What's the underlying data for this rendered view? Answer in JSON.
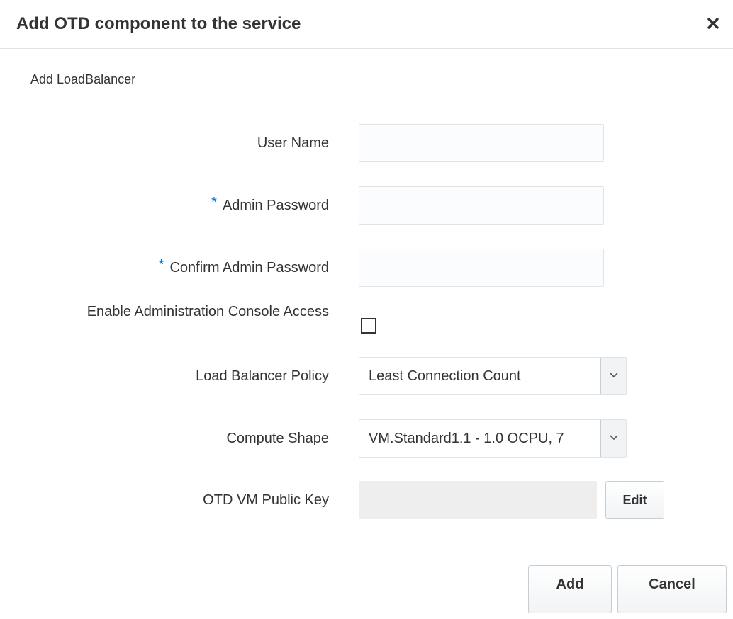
{
  "dialog": {
    "title": "Add OTD component to the service",
    "close_icon": "close-icon",
    "section_title": "Add LoadBalancer"
  },
  "form": {
    "user_name": {
      "label": "User Name",
      "value": "",
      "required": false
    },
    "admin_password": {
      "label": "Admin Password",
      "value": "",
      "required": true,
      "required_marker": "*"
    },
    "confirm_admin_password": {
      "label": "Confirm Admin Password",
      "value": "",
      "required": true,
      "required_marker": "*"
    },
    "enable_console": {
      "label": "Enable Administration Console Access",
      "checked": false
    },
    "load_balancer_policy": {
      "label": "Load Balancer Policy",
      "selected": "Least Connection Count"
    },
    "compute_shape": {
      "label": "Compute Shape",
      "selected": "VM.Standard1.1 - 1.0 OCPU, 7"
    },
    "public_key": {
      "label": "OTD VM Public Key",
      "value": "",
      "edit_label": "Edit"
    }
  },
  "footer": {
    "add_label": "Add",
    "cancel_label": "Cancel"
  },
  "colors": {
    "required_marker": "#0572ce",
    "text": "#333333",
    "field_border": "#dfe4e8",
    "readonly_bg": "#eeeeee"
  }
}
